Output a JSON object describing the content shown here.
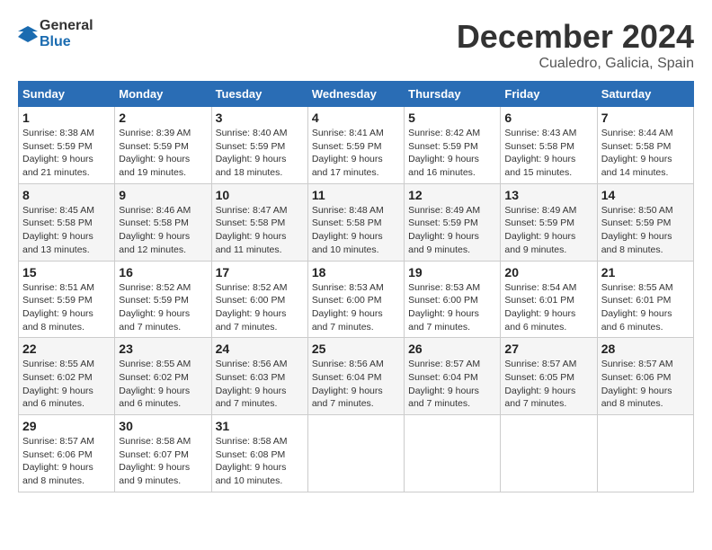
{
  "logo": {
    "text_general": "General",
    "text_blue": "Blue"
  },
  "header": {
    "month": "December 2024",
    "location": "Cualedro, Galicia, Spain"
  },
  "weekdays": [
    "Sunday",
    "Monday",
    "Tuesday",
    "Wednesday",
    "Thursday",
    "Friday",
    "Saturday"
  ],
  "weeks": [
    [
      {
        "day": "1",
        "sunrise": "8:38 AM",
        "sunset": "5:59 PM",
        "daylight": "9 hours and 21 minutes."
      },
      {
        "day": "2",
        "sunrise": "8:39 AM",
        "sunset": "5:59 PM",
        "daylight": "9 hours and 19 minutes."
      },
      {
        "day": "3",
        "sunrise": "8:40 AM",
        "sunset": "5:59 PM",
        "daylight": "9 hours and 18 minutes."
      },
      {
        "day": "4",
        "sunrise": "8:41 AM",
        "sunset": "5:59 PM",
        "daylight": "9 hours and 17 minutes."
      },
      {
        "day": "5",
        "sunrise": "8:42 AM",
        "sunset": "5:59 PM",
        "daylight": "9 hours and 16 minutes."
      },
      {
        "day": "6",
        "sunrise": "8:43 AM",
        "sunset": "5:58 PM",
        "daylight": "9 hours and 15 minutes."
      },
      {
        "day": "7",
        "sunrise": "8:44 AM",
        "sunset": "5:58 PM",
        "daylight": "9 hours and 14 minutes."
      }
    ],
    [
      {
        "day": "8",
        "sunrise": "8:45 AM",
        "sunset": "5:58 PM",
        "daylight": "9 hours and 13 minutes."
      },
      {
        "day": "9",
        "sunrise": "8:46 AM",
        "sunset": "5:58 PM",
        "daylight": "9 hours and 12 minutes."
      },
      {
        "day": "10",
        "sunrise": "8:47 AM",
        "sunset": "5:58 PM",
        "daylight": "9 hours and 11 minutes."
      },
      {
        "day": "11",
        "sunrise": "8:48 AM",
        "sunset": "5:58 PM",
        "daylight": "9 hours and 10 minutes."
      },
      {
        "day": "12",
        "sunrise": "8:49 AM",
        "sunset": "5:59 PM",
        "daylight": "9 hours and 9 minutes."
      },
      {
        "day": "13",
        "sunrise": "8:49 AM",
        "sunset": "5:59 PM",
        "daylight": "9 hours and 9 minutes."
      },
      {
        "day": "14",
        "sunrise": "8:50 AM",
        "sunset": "5:59 PM",
        "daylight": "9 hours and 8 minutes."
      }
    ],
    [
      {
        "day": "15",
        "sunrise": "8:51 AM",
        "sunset": "5:59 PM",
        "daylight": "9 hours and 8 minutes."
      },
      {
        "day": "16",
        "sunrise": "8:52 AM",
        "sunset": "5:59 PM",
        "daylight": "9 hours and 7 minutes."
      },
      {
        "day": "17",
        "sunrise": "8:52 AM",
        "sunset": "6:00 PM",
        "daylight": "9 hours and 7 minutes."
      },
      {
        "day": "18",
        "sunrise": "8:53 AM",
        "sunset": "6:00 PM",
        "daylight": "9 hours and 7 minutes."
      },
      {
        "day": "19",
        "sunrise": "8:53 AM",
        "sunset": "6:00 PM",
        "daylight": "9 hours and 7 minutes."
      },
      {
        "day": "20",
        "sunrise": "8:54 AM",
        "sunset": "6:01 PM",
        "daylight": "9 hours and 6 minutes."
      },
      {
        "day": "21",
        "sunrise": "8:55 AM",
        "sunset": "6:01 PM",
        "daylight": "9 hours and 6 minutes."
      }
    ],
    [
      {
        "day": "22",
        "sunrise": "8:55 AM",
        "sunset": "6:02 PM",
        "daylight": "9 hours and 6 minutes."
      },
      {
        "day": "23",
        "sunrise": "8:55 AM",
        "sunset": "6:02 PM",
        "daylight": "9 hours and 6 minutes."
      },
      {
        "day": "24",
        "sunrise": "8:56 AM",
        "sunset": "6:03 PM",
        "daylight": "9 hours and 7 minutes."
      },
      {
        "day": "25",
        "sunrise": "8:56 AM",
        "sunset": "6:04 PM",
        "daylight": "9 hours and 7 minutes."
      },
      {
        "day": "26",
        "sunrise": "8:57 AM",
        "sunset": "6:04 PM",
        "daylight": "9 hours and 7 minutes."
      },
      {
        "day": "27",
        "sunrise": "8:57 AM",
        "sunset": "6:05 PM",
        "daylight": "9 hours and 7 minutes."
      },
      {
        "day": "28",
        "sunrise": "8:57 AM",
        "sunset": "6:06 PM",
        "daylight": "9 hours and 8 minutes."
      }
    ],
    [
      {
        "day": "29",
        "sunrise": "8:57 AM",
        "sunset": "6:06 PM",
        "daylight": "9 hours and 8 minutes."
      },
      {
        "day": "30",
        "sunrise": "8:58 AM",
        "sunset": "6:07 PM",
        "daylight": "9 hours and 9 minutes."
      },
      {
        "day": "31",
        "sunrise": "8:58 AM",
        "sunset": "6:08 PM",
        "daylight": "9 hours and 10 minutes."
      },
      null,
      null,
      null,
      null
    ]
  ]
}
